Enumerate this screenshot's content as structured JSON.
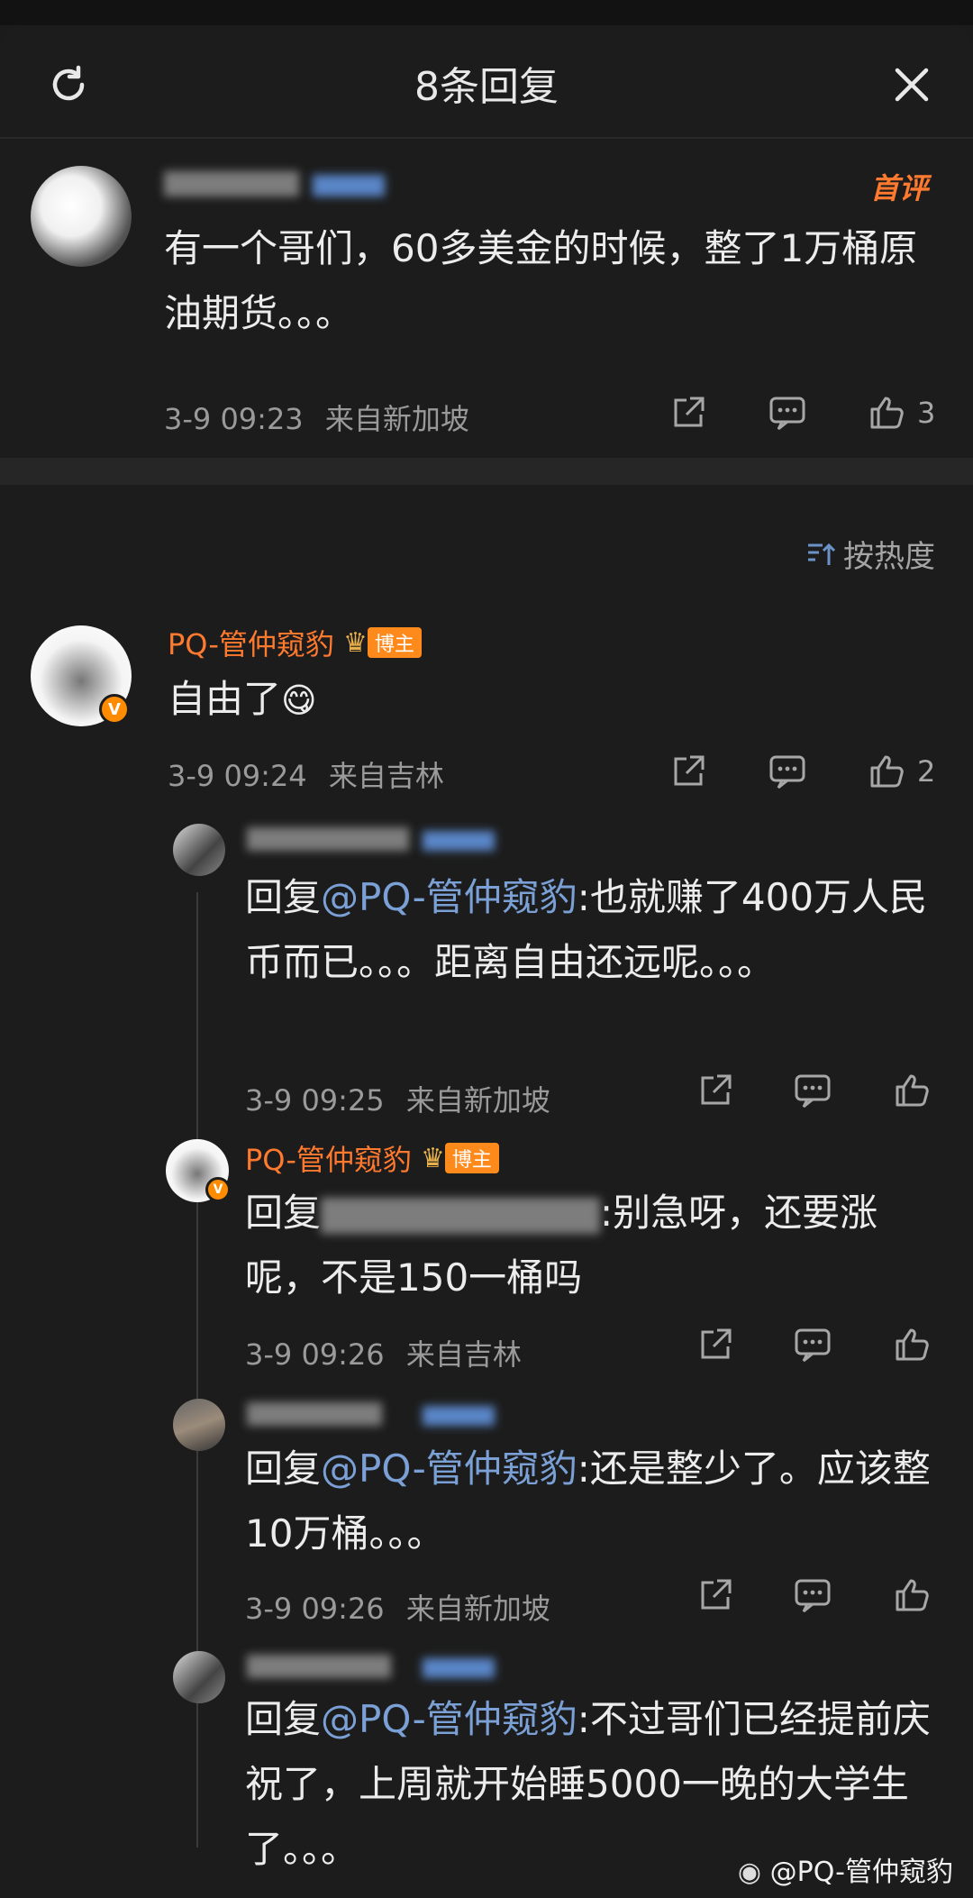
{
  "header": {
    "title": "8条回复"
  },
  "root_comment": {
    "first_badge": "首评",
    "content": "有一个哥们，60多美金的时候，整了1万桶原油期货。。。",
    "time": "3-9 09:23",
    "location": "来自新加坡",
    "likes": "3"
  },
  "sort_label": "按热度",
  "replies": [
    {
      "author": "PQ-管仲窥豹",
      "role_tag": "博主",
      "content": "自由了",
      "time": "3-9 09:24",
      "location": "来自吉林",
      "likes": "2"
    },
    {
      "reply_prefix": "回复",
      "mention": "@PQ-管仲窥豹",
      "content": ":也就赚了400万人民币而已。。。距离自由还远呢。。。",
      "time": "3-9 09:25",
      "location": "来自新加坡"
    },
    {
      "author": "PQ-管仲窥豹",
      "role_tag": "博主",
      "reply_prefix": "回复",
      "content": ":别急呀，还要涨呢，不是150一桶吗",
      "time": "3-9 09:26",
      "location": "来自吉林"
    },
    {
      "reply_prefix": "回复",
      "mention": "@PQ-管仲窥豹",
      "content": ":还是整少了。应该整10万桶。。。",
      "time": "3-9 09:26",
      "location": "来自新加坡"
    },
    {
      "reply_prefix": "回复",
      "mention": "@PQ-管仲窥豹",
      "content": ":不过哥们已经提前庆祝了，上周就开始睡5000一晚的大学生了。。。"
    }
  ],
  "watermark": "@PQ-管仲窥豹",
  "colors": {
    "accent": "#ff7a2f",
    "mention": "#7aa0d6",
    "background": "#1c1c1c"
  }
}
